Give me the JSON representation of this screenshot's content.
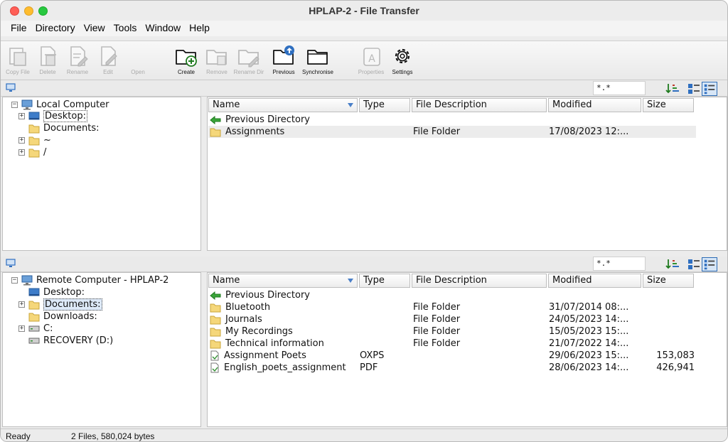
{
  "window": {
    "title": "HPLAP-2 - File Transfer"
  },
  "menu": [
    "File",
    "Directory",
    "View",
    "Tools",
    "Window",
    "Help"
  ],
  "toolbar": [
    {
      "label": "Copy File",
      "icon": "copy-file-icon",
      "enabled": false
    },
    {
      "label": "Delete",
      "icon": "delete-file-icon",
      "enabled": false
    },
    {
      "label": "Rename",
      "icon": "rename-file-icon",
      "enabled": false
    },
    {
      "label": "Edit",
      "icon": "edit-file-icon",
      "enabled": false
    },
    {
      "label": "Open",
      "icon": "open-file-icon",
      "enabled": false
    },
    {
      "label": "Create",
      "icon": "create-folder-icon",
      "enabled": true
    },
    {
      "label": "Remove",
      "icon": "remove-folder-icon",
      "enabled": false
    },
    {
      "label": "Rename Dir",
      "icon": "rename-folder-icon",
      "enabled": false
    },
    {
      "label": "Previous",
      "icon": "previous-folder-icon",
      "enabled": true
    },
    {
      "label": "Synchronise",
      "icon": "synchronise-folder-icon",
      "enabled": true
    },
    {
      "label": "Properties",
      "icon": "properties-icon",
      "enabled": false
    },
    {
      "label": "Settings",
      "icon": "gear-icon",
      "enabled": true
    }
  ],
  "local": {
    "filter": "*.*",
    "tree": {
      "root": "Local Computer",
      "items": [
        "Desktop:",
        "Documents:",
        "~",
        "/"
      ]
    },
    "columns": [
      "Name",
      "Type",
      "File Description",
      "Modified",
      "Size"
    ],
    "rows": [
      {
        "name": "Previous Directory",
        "type": "",
        "desc": "",
        "modified": "",
        "size": "",
        "kind": "up"
      },
      {
        "name": "Assignments",
        "type": "",
        "desc": "File Folder",
        "modified": "17/08/2023 12:...",
        "size": "",
        "kind": "folder"
      }
    ]
  },
  "remote": {
    "filter": "*.*",
    "tree": {
      "root": "Remote Computer - HPLAP-2",
      "items": [
        "Desktop:",
        "Documents:",
        "Downloads:",
        "C:",
        "RECOVERY (D:)"
      ]
    },
    "columns": [
      "Name",
      "Type",
      "File Description",
      "Modified",
      "Size"
    ],
    "rows": [
      {
        "name": "Previous Directory",
        "type": "",
        "desc": "",
        "modified": "",
        "size": "",
        "kind": "up"
      },
      {
        "name": "Bluetooth",
        "type": "",
        "desc": "File Folder",
        "modified": "31/07/2014 08:...",
        "size": "",
        "kind": "folder"
      },
      {
        "name": "Journals",
        "type": "",
        "desc": "File Folder",
        "modified": "24/05/2023 14:...",
        "size": "",
        "kind": "folder"
      },
      {
        "name": "My Recordings",
        "type": "",
        "desc": "File Folder",
        "modified": "15/05/2023 15:...",
        "size": "",
        "kind": "folder"
      },
      {
        "name": "Technical information",
        "type": "",
        "desc": "File Folder",
        "modified": "21/07/2022 14:...",
        "size": "",
        "kind": "folder"
      },
      {
        "name": "Assignment Poets",
        "type": "OXPS",
        "desc": "",
        "modified": "29/06/2023 15:...",
        "size": "153,083",
        "kind": "file"
      },
      {
        "name": "English_poets_assignment",
        "type": "PDF",
        "desc": "",
        "modified": "28/06/2023 14:...",
        "size": "426,941",
        "kind": "file"
      }
    ]
  },
  "status": {
    "state": "Ready",
    "summary": "2 Files, 580,024 bytes"
  }
}
